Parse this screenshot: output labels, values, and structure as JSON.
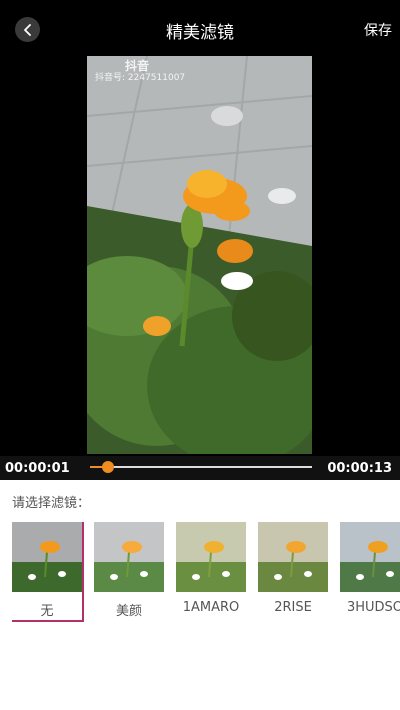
{
  "header": {
    "title": "精美滤镜",
    "save_label": "保存"
  },
  "video": {
    "watermark_brand": "抖音",
    "watermark_id": "抖音号: 2247511007"
  },
  "timeline": {
    "current_time": "00:00:01",
    "total_time": "00:00:13",
    "progress": 0.08
  },
  "filters": {
    "prompt": "请选择滤镜：",
    "items": [
      {
        "label": "无",
        "selected": true
      },
      {
        "label": "美颜",
        "selected": false
      },
      {
        "label": "1AMARO",
        "selected": false
      },
      {
        "label": "2RISE",
        "selected": false
      },
      {
        "label": "3HUDSO",
        "selected": false
      }
    ]
  },
  "colors": {
    "accent": "#f08d22",
    "selected_border": "#b3306b"
  }
}
